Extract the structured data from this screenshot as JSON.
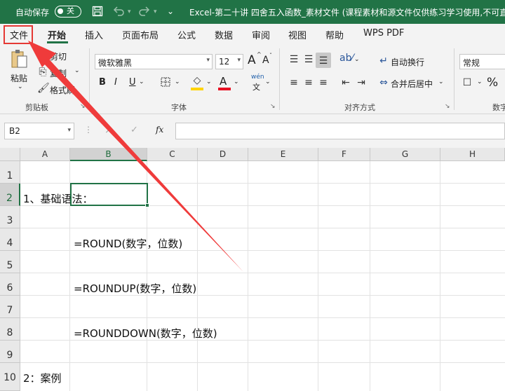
{
  "titlebar": {
    "autosave_label": "自动保存",
    "autosave_state": "关",
    "save_icon": "save-icon",
    "undo_icon": "undo-icon",
    "redo_icon": "redo-icon",
    "customize_icon": "customize-qat-icon",
    "title": "Excel-第二十讲 四舍五入函数_素材文件 (课程素材和源文件仅供练习学习使用,不可直",
    "brand_color": "#217346"
  },
  "tabs": {
    "items": [
      "文件",
      "开始",
      "插入",
      "页面布局",
      "公式",
      "数据",
      "审阅",
      "视图",
      "帮助",
      "WPS PDF"
    ],
    "active": "开始"
  },
  "ribbon": {
    "clipboard": {
      "paste_label": "粘贴",
      "cut_label": "剪切",
      "copy_label": "复制",
      "format_painter_label": "格式刷",
      "group_label": "剪贴板"
    },
    "font": {
      "font_name": "微软雅黑",
      "font_size": "12",
      "grow_icon": "A",
      "shrink_icon": "A",
      "bold": "B",
      "italic": "I",
      "underline": "U",
      "phonetic_top": "wén",
      "phonetic_bottom": "文",
      "group_label": "字体",
      "fill_color": "#ffd400",
      "font_color": "#e81123"
    },
    "alignment": {
      "wrap_label": "自动换行",
      "merge_label": "合并后居中",
      "group_label": "对齐方式"
    },
    "number": {
      "format": "常规",
      "percent": "%",
      "group_label": "数字"
    }
  },
  "formula_bar": {
    "name_box": "B2",
    "cancel_icon": "×",
    "enter_icon": "✓",
    "fx": "fx",
    "value": ""
  },
  "sheet": {
    "columns": [
      "A",
      "B",
      "C",
      "D",
      "E",
      "F",
      "G",
      "H"
    ],
    "selected_column": "B",
    "rows": [
      "1",
      "2",
      "3",
      "4",
      "5",
      "6",
      "7",
      "8",
      "9",
      "10"
    ],
    "selected_row": "2",
    "cells": {
      "A2": "1、基础语法：",
      "B4": "=ROUND(数字，位数)",
      "B6": "=ROUNDUP(数字，位数)",
      "B8": "=ROUNDDOWN(数字，位数)",
      "A10": "2：案例"
    }
  },
  "annotation": {
    "highlight_color": "#e53935",
    "target": "文件"
  }
}
